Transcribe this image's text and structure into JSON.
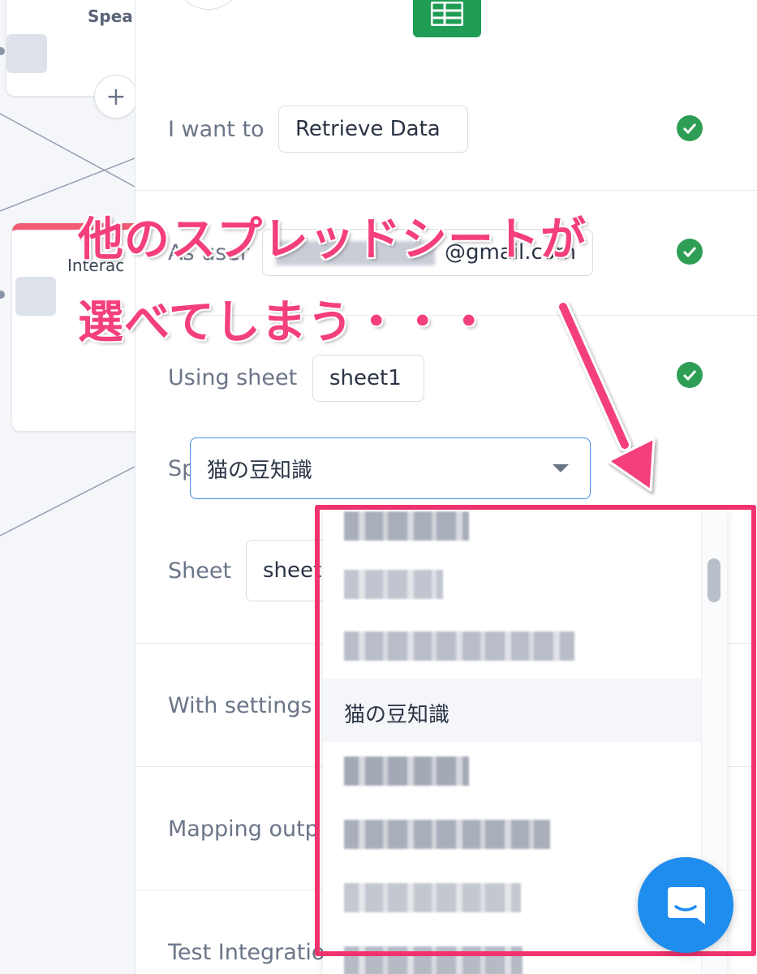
{
  "canvas": {
    "node_top_title": "Spea",
    "node_mid_title": "Interac",
    "add_symbol": "+"
  },
  "form": {
    "action_label": "I want to",
    "action_value": "Retrieve Data",
    "user_label": "As user",
    "user_value": "@gmail.com",
    "using_sheet_label": "Using sheet",
    "using_sheet_value": "sheet1",
    "spreadsheet_label": "Spreadsheet",
    "spreadsheet_value": "猫の豆知識",
    "sheet_label": "Sheet",
    "sheet_value": "sheet",
    "with_settings_label": "With settings",
    "mapping_label": "Mapping outp",
    "test_label": "Test Integratio"
  },
  "dropdown": {
    "selected_option": "猫の豆知識",
    "options_note": "other options pixelated"
  },
  "annotation": {
    "line1": "他のスプレッドシートが",
    "line2": "選べてしまう・・・",
    "color": "#f0336e"
  },
  "colors": {
    "accent_blue": "#3d8fe0",
    "check_green": "#2e9e55",
    "sheets_green": "#1f9d55",
    "chat_blue": "#1f8ded"
  }
}
